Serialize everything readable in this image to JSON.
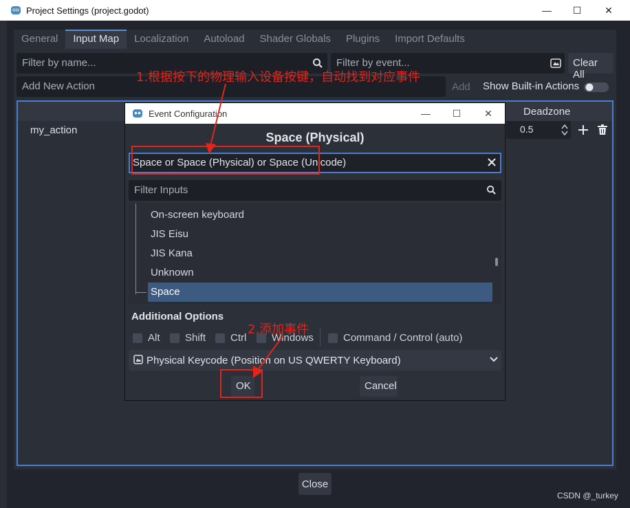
{
  "window": {
    "title": "Project Settings (project.godot)",
    "minimize": "—",
    "maximize": "☐",
    "close": "✕"
  },
  "tabs": [
    "General",
    "Input Map",
    "Localization",
    "Autoload",
    "Shader Globals",
    "Plugins",
    "Import Defaults"
  ],
  "toolbar": {
    "filter_name_placeholder": "Filter by name...",
    "filter_event_placeholder": "Filter by event...",
    "clear_all": "Clear All",
    "new_action_placeholder": "Add New Action",
    "add": "Add",
    "show_builtin": "Show Built-in Actions"
  },
  "tree": {
    "deadzone_header": "Deadzone",
    "action_name": "my_action",
    "deadzone_value": "0.5"
  },
  "close_button": "Close",
  "dialog": {
    "title": "Event Configuration",
    "heading": "Space (Physical)",
    "event_text": "Space or Space (Physical) or Space (Unicode)",
    "filter_placeholder": "Filter Inputs",
    "list": [
      "On-screen keyboard",
      "JIS Eisu",
      "JIS Kana",
      "Unknown",
      "Space"
    ],
    "selected_index": 4,
    "additional_options": "Additional Options",
    "modifiers": [
      "Alt",
      "Shift",
      "Ctrl",
      "Windows",
      "Command / Control (auto)"
    ],
    "keycode_mode": "Physical Keycode (Position on US QWERTY Keyboard)",
    "ok": "OK",
    "cancel": "Cancel"
  },
  "annotations": {
    "note1": "1.根据按下的物理输入设备按键，自动找到对应事件",
    "note2": "2.添加事件",
    "color": "#e1251b"
  },
  "watermark": "CSDN @_turkey",
  "colors": {
    "accent": "#4c7ed0",
    "selected_row": "#3d5a80"
  }
}
